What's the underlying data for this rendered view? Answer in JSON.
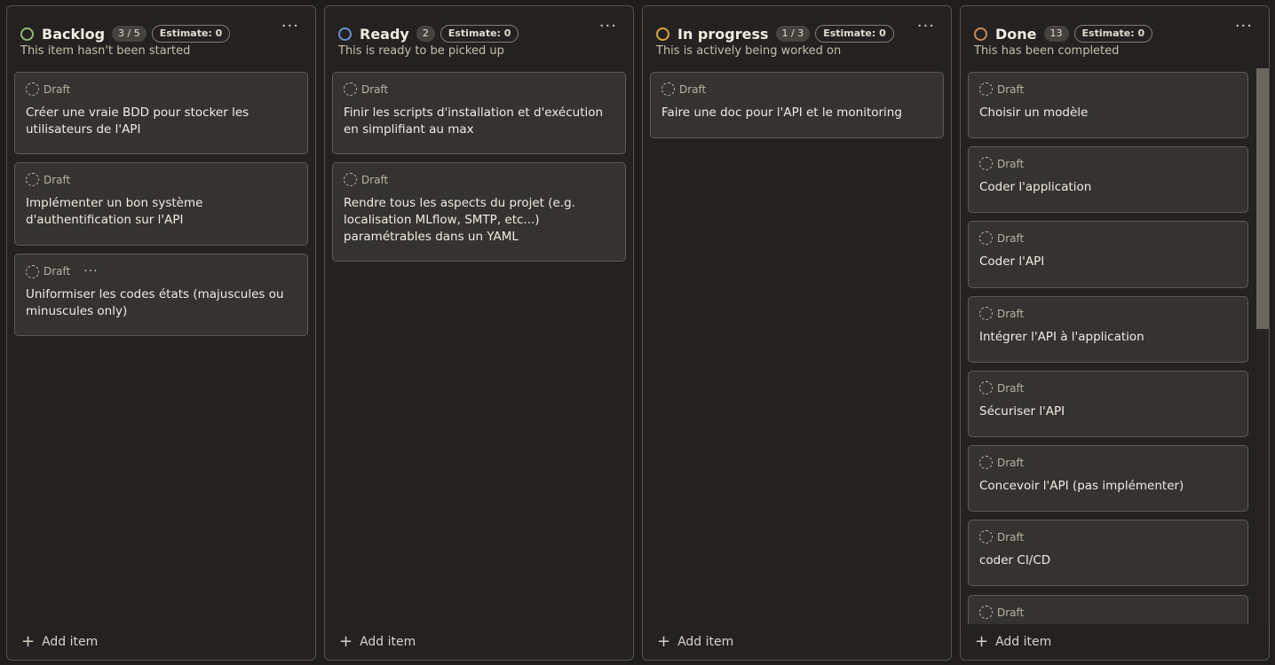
{
  "columns": [
    {
      "title": "Backlog",
      "count": "3 / 5",
      "estimate": "Estimate: 0",
      "description": "This item hasn't been started",
      "status_color": "#8fb876",
      "add_label": "Add item",
      "cards": [
        {
          "status": "Draft",
          "title": "Créer une vraie BDD pour stocker les utilisateurs de l'API"
        },
        {
          "status": "Draft",
          "title": "Implémenter un bon système d'authentification sur l'API"
        },
        {
          "status": "Draft",
          "title": "Uniformiser les codes états (majuscules ou minuscules only)",
          "menu": "···"
        }
      ]
    },
    {
      "title": "Ready",
      "count": "2",
      "estimate": "Estimate: 0",
      "description": "This is ready to be picked up",
      "status_color": "#6b8fcf",
      "add_label": "Add item",
      "cards": [
        {
          "status": "Draft",
          "title": "Finir les scripts d'installation et d'exécution en simplifiant au max"
        },
        {
          "status": "Draft",
          "title": "Rendre tous les aspects du projet (e.g. localisation MLflow, SMTP, etc...) paramétrables dans un YAML"
        }
      ]
    },
    {
      "title": "In progress",
      "count": "1 / 3",
      "estimate": "Estimate: 0",
      "description": "This is actively being worked on",
      "status_color": "#d9a93a",
      "add_label": "Add item",
      "cards": [
        {
          "status": "Draft",
          "title": "Faire une doc pour l'API et le monitoring"
        }
      ]
    },
    {
      "title": "Done",
      "count": "13",
      "estimate": "Estimate: 0",
      "description": "This has been completed",
      "status_color": "#c98a5a",
      "add_label": "Add item",
      "cards": [
        {
          "status": "Draft",
          "title": "Choisir un modèle"
        },
        {
          "status": "Draft",
          "title": "Coder l'application"
        },
        {
          "status": "Draft",
          "title": "Coder l'API"
        },
        {
          "status": "Draft",
          "title": "Intégrer l'API à l'application"
        },
        {
          "status": "Draft",
          "title": "Sécuriser l'API"
        },
        {
          "status": "Draft",
          "title": "Concevoir l'API (pas implémenter)"
        },
        {
          "status": "Draft",
          "title": "coder CI/CD"
        },
        {
          "status": "Draft",
          "title": ""
        }
      ]
    }
  ],
  "column_menu": "···",
  "add_icon": "+"
}
